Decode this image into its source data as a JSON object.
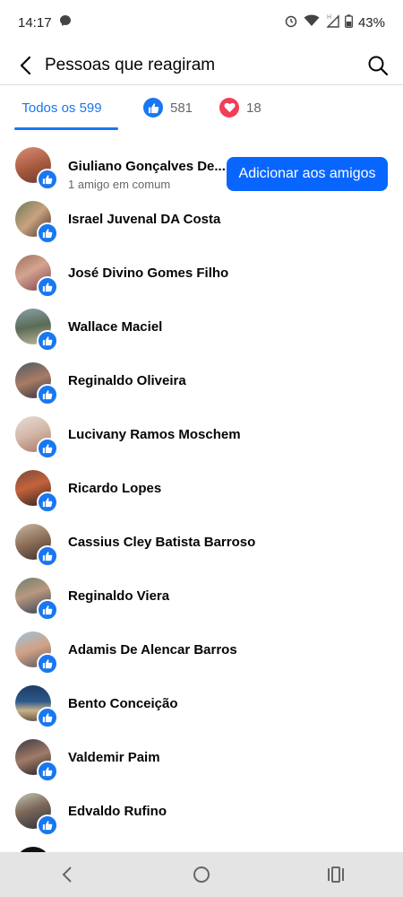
{
  "status": {
    "time": "14:17",
    "battery": "43%"
  },
  "header": {
    "title": "Pessoas que reagiram"
  },
  "tabs": [
    {
      "label": "Todos os 599"
    },
    {
      "label": "581",
      "icon": "like-icon"
    },
    {
      "label": "18",
      "icon": "love-icon"
    }
  ],
  "people": [
    {
      "name": "Giuliano Gonçalves De...",
      "sub": "1 amigo em comum",
      "action": "Adicionar aos amigos"
    },
    {
      "name": "Israel Juvenal DA Costa"
    },
    {
      "name": "José Divino Gomes Filho"
    },
    {
      "name": "Wallace Maciel"
    },
    {
      "name": "Reginaldo Oliveira"
    },
    {
      "name": "Lucivany Ramos Moschem"
    },
    {
      "name": "Ricardo Lopes"
    },
    {
      "name": "Cassius Cley Batista Barroso"
    },
    {
      "name": "Reginaldo Viera"
    },
    {
      "name": "Adamis De Alencar Barros"
    },
    {
      "name": "Bento Conceição"
    },
    {
      "name": "Valdemir Paim"
    },
    {
      "name": "Edvaldo Rufino"
    }
  ],
  "colors": {
    "accent": "#1877f2",
    "button": "#0866ff",
    "love": "#f33e58"
  }
}
